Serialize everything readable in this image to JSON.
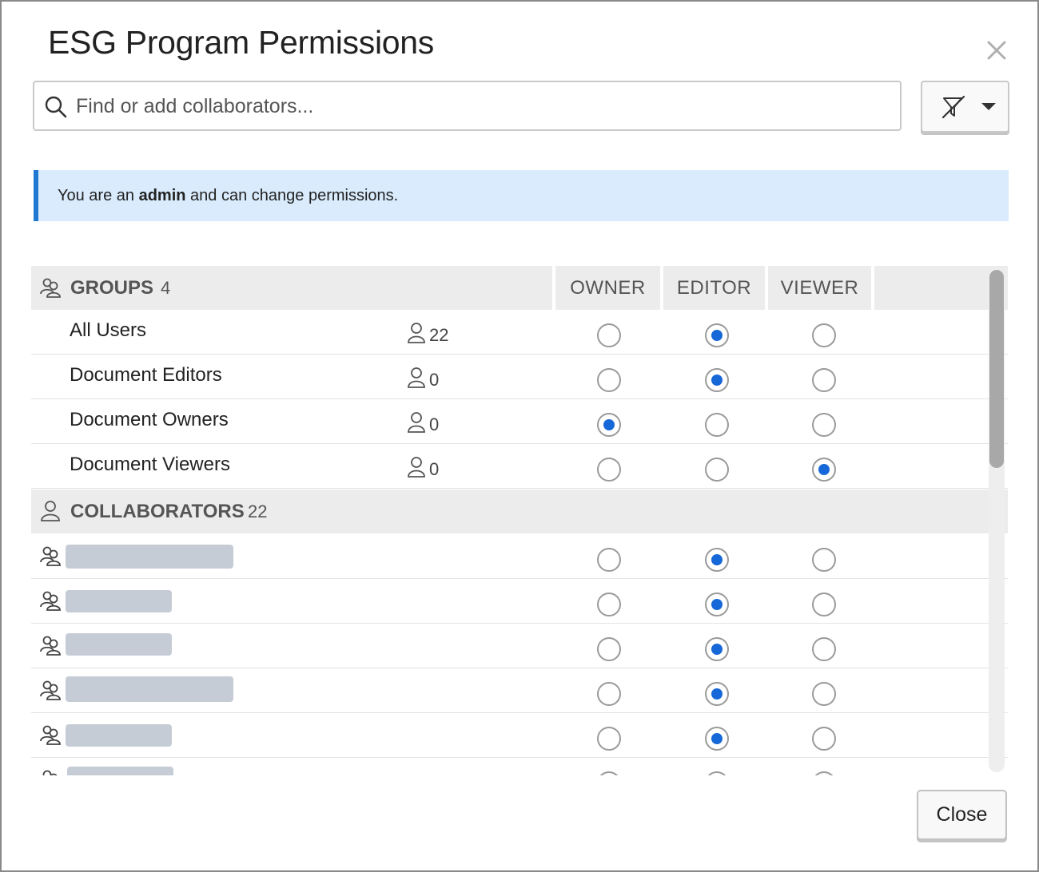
{
  "dialog": {
    "title": "ESG Program Permissions",
    "close_icon": "close-icon"
  },
  "search": {
    "placeholder": "Find or add collaborators...",
    "icon": "search-icon"
  },
  "filter_button": {
    "icon": "filter-off-icon",
    "caret": "caret-down-icon"
  },
  "banner": {
    "prefix": "You are an ",
    "role": "admin",
    "suffix": " and can change permissions."
  },
  "columns": {
    "owner": "OWNER",
    "editor": "EDITOR",
    "viewer": "VIEWER"
  },
  "groups": {
    "label": "GROUPS",
    "count": "4",
    "icon": "group-icon",
    "rows": [
      {
        "name": "All Users",
        "members": "22",
        "permission": "editor"
      },
      {
        "name": "Document Editors",
        "members": "0",
        "permission": "editor"
      },
      {
        "name": "Document Owners",
        "members": "0",
        "permission": "owner"
      },
      {
        "name": "Document Viewers",
        "members": "0",
        "permission": "viewer"
      }
    ]
  },
  "collaborators": {
    "label": "COLLABORATORS",
    "count": "22",
    "icon": "user-icon",
    "rows": [
      {
        "permission": "editor",
        "redacted": true
      },
      {
        "permission": "editor",
        "redacted": true
      },
      {
        "permission": "editor",
        "redacted": true
      },
      {
        "permission": "editor",
        "redacted": true
      },
      {
        "permission": "editor",
        "redacted": true
      },
      {
        "permission": "editor",
        "redacted": true
      }
    ]
  },
  "colors": {
    "accent": "#1668d8",
    "banner_bg": "#d9ebfc",
    "banner_border": "#1f78d1",
    "header_bg": "#ececec"
  },
  "footer": {
    "close_label": "Close"
  }
}
